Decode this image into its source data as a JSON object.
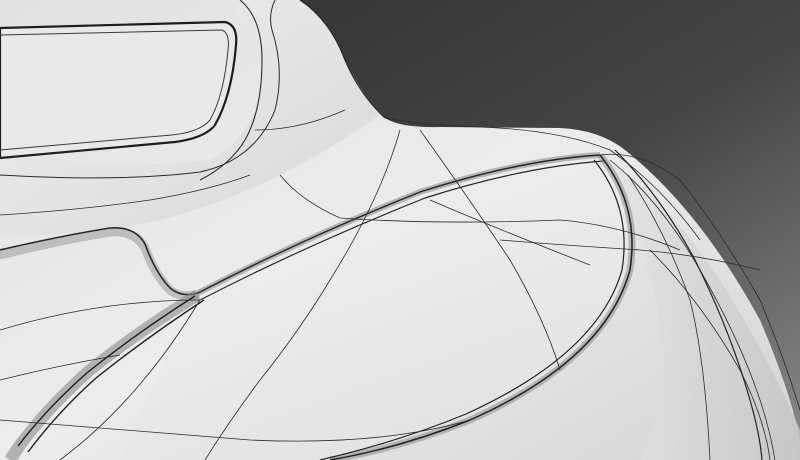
{
  "scene": {
    "subject": "3d-surface-model-wireframe-shaded",
    "background_gradient": [
      "#2f2f2f",
      "#4a4a4a",
      "#7a7a7a"
    ],
    "surface_fill": [
      "#dcdcdc",
      "#eaeaea",
      "#f3f3f3"
    ],
    "shadow_color": "#9e9e9e",
    "wire_color": "#2a2a2a"
  }
}
